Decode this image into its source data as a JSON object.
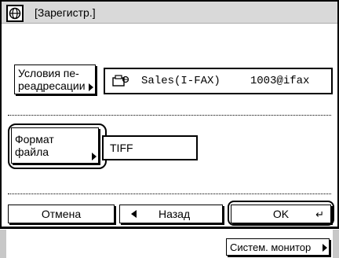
{
  "header": {
    "title": "[Зарегистр.]",
    "icon": "fax-globe-icon"
  },
  "forwarding": {
    "conditions_button_line1": "Условия пе-",
    "conditions_button_line2": "реадресации",
    "destination_type": "Sales(I-FAX)",
    "destination_address": "1003@ifax",
    "destination_icon": "ifax-icon"
  },
  "format": {
    "button_line1": "Формат",
    "button_line2": "файла",
    "value": "TIFF"
  },
  "actions": {
    "cancel_label": "Отмена",
    "back_label": "Назад",
    "ok_label": "OK"
  },
  "status": {
    "monitor_label": "Систем. монитор"
  }
}
